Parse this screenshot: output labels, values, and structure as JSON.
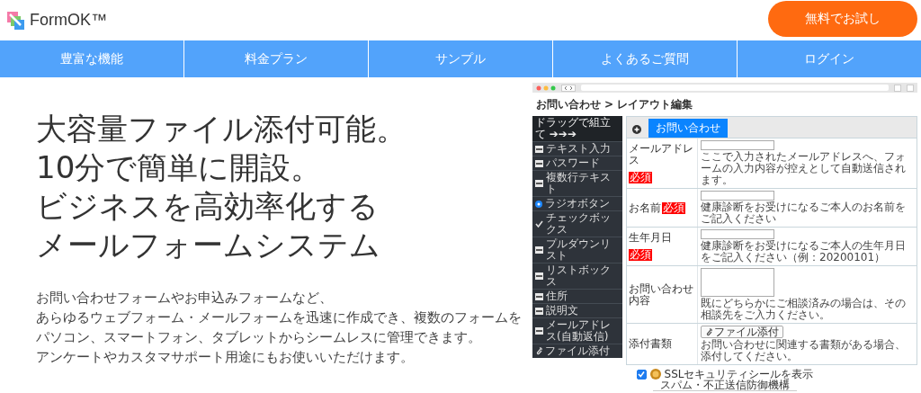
{
  "header": {
    "logo": "FormOK™",
    "cta": "無料でお試し"
  },
  "nav": [
    "豊富な機能",
    "料金プラン",
    "サンプル",
    "よくあるご質問",
    "ログイン"
  ],
  "hero": {
    "headline": [
      "大容量ファイル添付可能。",
      "10分で簡単に開設。",
      "ビジネスを高効率化する",
      "メールフォームシステム"
    ],
    "description": [
      "お問い合わせフォームやお申込みフォームなど、",
      "あらゆるウェブフォーム・メールフォームを迅速に作成でき、複数のフォームを",
      "パソコン、スマートフォン、タブレットからシームレスに管理できます。",
      "アンケートやカスタマサポート用途にもお使いいただけます。"
    ]
  },
  "app_screenshot": {
    "title": "お問い合わせ",
    "breadcrumb": "> レイアウト編集",
    "palette": {
      "heading": "ドラッグで組立て ➔➔➔",
      "items": [
        {
          "label": "テキスト入力",
          "kind": "box"
        },
        {
          "label": "パスワード",
          "kind": "box"
        },
        {
          "label": "複数行テキスト",
          "kind": "box"
        },
        {
          "label": "ラジオボタン",
          "kind": "radio"
        },
        {
          "label": "チェックボックス",
          "kind": "check"
        },
        {
          "label": "プルダウンリスト",
          "kind": "box"
        },
        {
          "label": "リストボックス",
          "kind": "box"
        },
        {
          "label": "住所",
          "kind": "box"
        },
        {
          "label": "説明文",
          "kind": "box"
        },
        {
          "label": "メールアドレス(自動返信)",
          "kind": "box"
        },
        {
          "label": "ファイル添付",
          "kind": "clip"
        }
      ]
    },
    "tabs": [
      {
        "label": "お問い合わせ",
        "selected": true
      }
    ],
    "rows": [
      {
        "label": "メールアドレス",
        "badge": "必須",
        "kind": "text",
        "note": "ここで入力されたメールアドレスへ、フォームの入力内容が控えとして自動送信されます。"
      },
      {
        "label": "お名前",
        "badge": "必須",
        "kind": "text",
        "note": "健康診断をお受けになるご本人のお名前をご記入ください"
      },
      {
        "label": "生年月日",
        "badge": "必須",
        "kind": "text",
        "note": "健康診断をお受けになるご本人の生年月日をご記入ください（例：20200101）"
      },
      {
        "label": "お問い合わせ内容",
        "kind": "textarea",
        "note": "既にどちらかにご相談済みの場合は、その相談先をご入力ください。"
      },
      {
        "label": "添付書類",
        "kind": "file",
        "button": "ファイル添付",
        "note": "お問い合わせに関連する書類がある場合、添付してください。"
      }
    ],
    "ssl": {
      "label": "SSLセキュリティシールを表示",
      "checked": true
    },
    "footer": "スパム・不正送信防御機構"
  }
}
